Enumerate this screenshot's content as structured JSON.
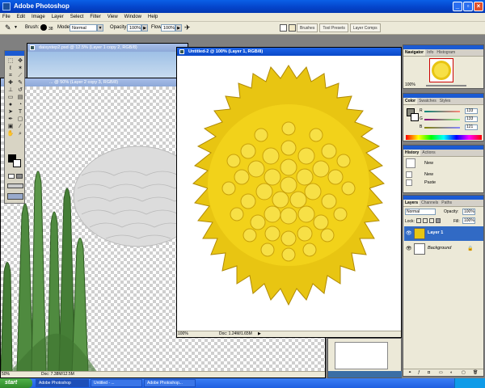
{
  "app": {
    "title": "Adobe Photoshop"
  },
  "menu": [
    "File",
    "Edit",
    "Image",
    "Layer",
    "Select",
    "Filter",
    "View",
    "Window",
    "Help"
  ],
  "options": {
    "brush_label": "Brush:",
    "brush_size": "38",
    "mode_label": "Mode:",
    "mode_value": "Normal",
    "opacity_label": "Opacity:",
    "opacity_value": "100%",
    "flow_label": "Flow:",
    "flow_value": "100%",
    "palette_tabs": [
      "Brushes",
      "Tool Presets",
      "Layer Comps"
    ]
  },
  "documents": {
    "back": {
      "title": "daisystep2.psd @ 12.5% (Layer 1 copy 2, RGB/8)"
    },
    "middle": {
      "title": "... @ 50% (Layer 2 copy 3, RGB/8)",
      "zoom": "50%",
      "doc": "Doc: 7.38M/12.5M"
    },
    "active": {
      "title": "Untitled-2 @ 100% (Layer 1, RGB/8)",
      "zoom": "100%",
      "doc": "Doc: 1.24M/1.65M"
    }
  },
  "navigator": {
    "tabs": [
      "Navigator",
      "Info",
      "Histogram"
    ],
    "zoom": "100%"
  },
  "color": {
    "tabs": [
      "Color",
      "Swatches",
      "Styles"
    ],
    "channels": [
      {
        "label": "R",
        "value": "133",
        "color": "#d04040"
      },
      {
        "label": "G",
        "value": "133",
        "color": "#40a040"
      },
      {
        "label": "B",
        "value": "121",
        "color": "#4060d0"
      }
    ]
  },
  "history": {
    "tabs": [
      "History",
      "Actions"
    ],
    "items": [
      "New",
      "New",
      "Paste"
    ]
  },
  "layers": {
    "tabs": [
      "Layers",
      "Channels",
      "Paths"
    ],
    "blend_mode": "Normal",
    "opacity_label": "Opacity:",
    "opacity_value": "100%",
    "lock_label": "Lock:",
    "fill_label": "Fill:",
    "fill_value": "100%",
    "items": [
      {
        "name": "Layer 1",
        "selected": true
      },
      {
        "name": "Background",
        "selected": false
      }
    ]
  },
  "taskbar": {
    "start": "start",
    "items": [
      "Adobe Photoshop",
      "Untitled - ...",
      "Adobe Photoshop..."
    ],
    "clock": ""
  },
  "colors": {
    "accent": "#0a49c8",
    "flower": "#f2d21a",
    "chrome": "#ece9d8"
  }
}
